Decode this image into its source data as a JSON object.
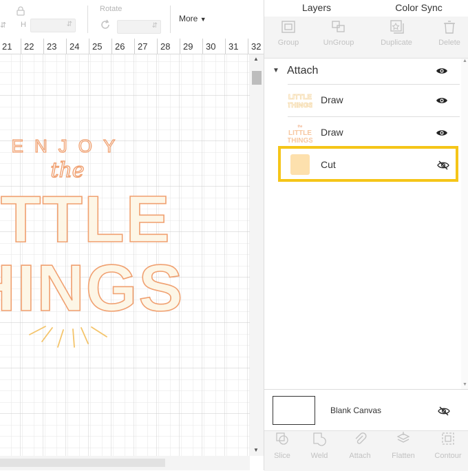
{
  "toolbar": {
    "h_label": "H",
    "rotate_label": "Rotate",
    "more_label": "More"
  },
  "ruler": {
    "numbers": [
      "21",
      "22",
      "23",
      "24",
      "25",
      "26",
      "27",
      "28",
      "29",
      "30",
      "31",
      "32"
    ]
  },
  "artwork": {
    "line1": "ENJOY",
    "line2": "the",
    "line3": "LITTLE",
    "line4": "THINGS"
  },
  "panel": {
    "tabs": [
      "Layers",
      "Color Sync"
    ],
    "tools": [
      "Group",
      "UnGroup",
      "Duplicate",
      "Delete"
    ],
    "group": {
      "name": "Attach"
    },
    "layers": [
      {
        "name": "Draw",
        "visible": true
      },
      {
        "name": "Draw",
        "visible": true
      },
      {
        "name": "Cut",
        "visible": false,
        "swatch": "#fde0ad",
        "highlighted": true
      }
    ],
    "blank_canvas": "Blank Canvas",
    "bottom_tools": [
      "Slice",
      "Weld",
      "Attach",
      "Flatten",
      "Contour"
    ]
  },
  "colors": {
    "highlight": "#f5c518",
    "artwork_orange": "#f0a070",
    "artwork_yellow": "#f4c46a",
    "cut_swatch": "#fde0ad"
  }
}
